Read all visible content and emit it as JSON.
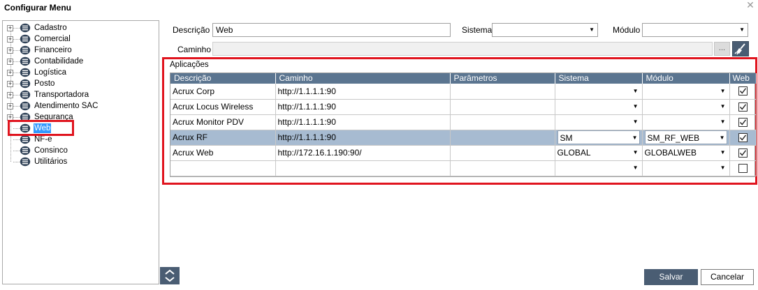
{
  "window": {
    "title": "Configurar Menu",
    "close_glyph": "✕"
  },
  "tree": {
    "items": [
      {
        "label": "Cadastro",
        "expandable": true
      },
      {
        "label": "Comercial",
        "expandable": true
      },
      {
        "label": "Financeiro",
        "expandable": true
      },
      {
        "label": "Contabilidade",
        "expandable": true
      },
      {
        "label": "Logística",
        "expandable": true
      },
      {
        "label": "Posto",
        "expandable": true
      },
      {
        "label": "Transportadora",
        "expandable": true
      },
      {
        "label": "Atendimento SAC",
        "expandable": true
      },
      {
        "label": "Segurança",
        "expandable": true
      },
      {
        "label": "Web",
        "expandable": false,
        "selected": true
      },
      {
        "label": "NF-e",
        "expandable": false
      },
      {
        "label": "Consinco",
        "expandable": false
      },
      {
        "label": "Utilitários",
        "expandable": false
      }
    ]
  },
  "form": {
    "descricao_label": "Descrição",
    "descricao_value": "Web",
    "sistema_label": "Sistema",
    "sistema_value": "",
    "modulo_label": "Módulo",
    "modulo_value": "",
    "caminho_label": "Caminho",
    "caminho_value": "",
    "dots_label": "..."
  },
  "aplicacoes": {
    "title": "Aplicações",
    "columns": [
      "Descrição",
      "Caminho",
      "Parâmetros",
      "Sistema",
      "Módulo",
      "Web"
    ],
    "rows": [
      {
        "descricao": "Acrux Corp",
        "caminho": "http://1.1.1.1:90",
        "parametros": "",
        "sistema": "",
        "modulo": "",
        "web": true,
        "highlighted": false
      },
      {
        "descricao": "Acrux Locus Wireless",
        "caminho": "http://1.1.1.1:90",
        "parametros": "",
        "sistema": "",
        "modulo": "",
        "web": true,
        "highlighted": false
      },
      {
        "descricao": "Acrux Monitor PDV",
        "caminho": "http://1.1.1.1:90",
        "parametros": "",
        "sistema": "",
        "modulo": "",
        "web": true,
        "highlighted": false
      },
      {
        "descricao": "Acrux RF",
        "caminho": "http://1.1.1.1:90",
        "parametros": "",
        "sistema": "SM",
        "modulo": "SM_RF_WEB",
        "web": true,
        "highlighted": true
      },
      {
        "descricao": "Acrux Web",
        "caminho": "http://172.16.1.190:90/",
        "parametros": "",
        "sistema": "GLOBAL",
        "modulo": "GLOBALWEB",
        "web": true,
        "highlighted": false
      },
      {
        "descricao": "",
        "caminho": "",
        "parametros": "",
        "sistema": "",
        "modulo": "",
        "web": false,
        "highlighted": false
      }
    ]
  },
  "buttons": {
    "salvar": "Salvar",
    "cancelar": "Cancelar"
  },
  "icons": {
    "expand": "plus-box-icon",
    "node": "menu-node-icon",
    "broom": "broom-icon",
    "nav": "up-down-chevron-icon",
    "dropdown": "chevron-down-icon"
  },
  "colors": {
    "header_bg": "#5b7590",
    "highlight_row": "#a7bbd1",
    "accent_button": "#4a5d73",
    "annotation_red": "#e0141e",
    "selection_blue": "#3399ff"
  }
}
